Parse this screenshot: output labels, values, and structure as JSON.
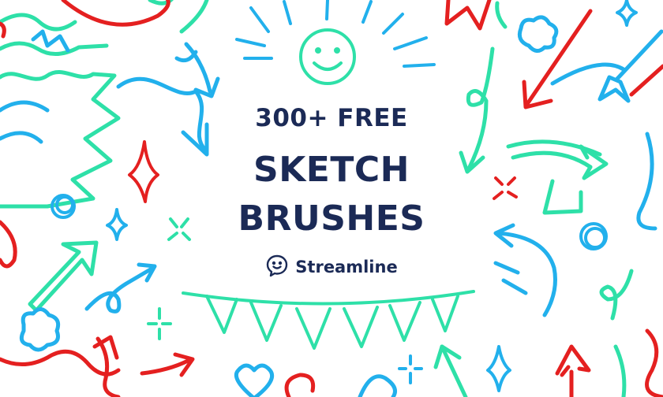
{
  "headline": {
    "line1": "300+ FREE",
    "line2": "SKETCH",
    "line3": "BRUSHES"
  },
  "brand": {
    "name": "Streamline",
    "icon": "chat-bubble-smile-icon"
  },
  "colors": {
    "text": "#1b2a56",
    "red": "#e42020",
    "blue": "#22b0ec",
    "green": "#2ee0a8"
  },
  "decorations": [
    "smiley-face-icon",
    "sunburst-rays",
    "pennant-bunting",
    "arrow-icon",
    "sparkle-icon",
    "heart-icon",
    "cloud-icon",
    "loop-doodle",
    "squiggle-doodle"
  ]
}
